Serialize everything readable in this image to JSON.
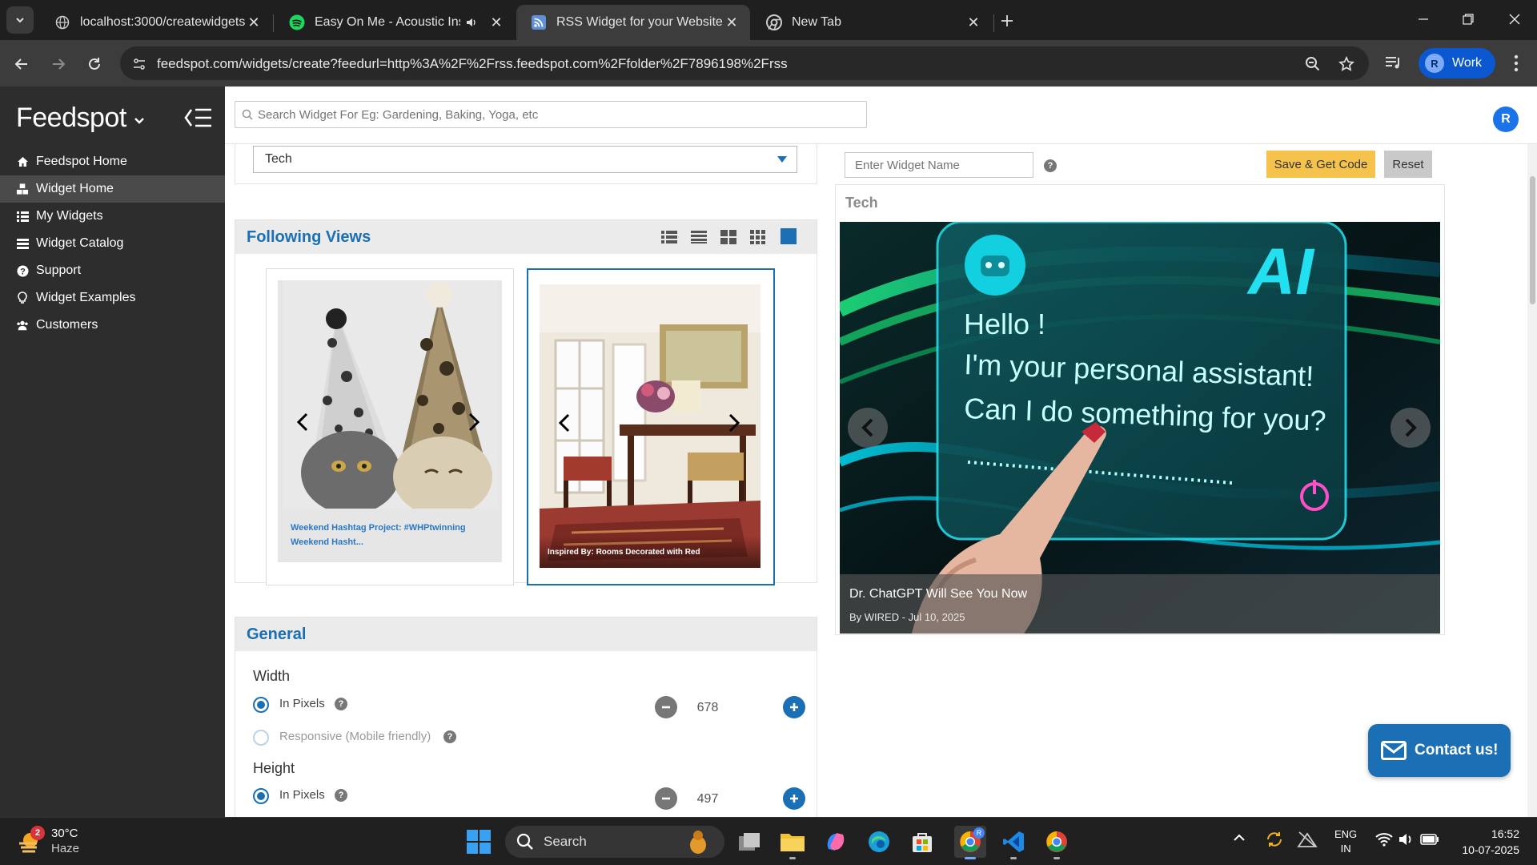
{
  "browser": {
    "tabs": [
      {
        "title": "localhost:3000/createwidgets",
        "icon": "globe-icon",
        "active": false
      },
      {
        "title": "Easy On Me - Acoustic Instr",
        "icon": "spotify-icon",
        "audio": true,
        "active": false
      },
      {
        "title": "RSS Widget for your Website | F",
        "icon": "rss-icon",
        "active": true
      },
      {
        "title": "New Tab",
        "icon": "chrome-icon",
        "active": false
      }
    ],
    "url": "feedspot.com/widgets/create?feedurl=http%3A%2F%2Frss.feedspot.com%2Ffolder%2F7896198%2Frss",
    "profile_initial": "R",
    "profile_label": "Work"
  },
  "sidebar": {
    "logo": "Feedspot",
    "items": [
      {
        "label": "Feedspot Home",
        "icon": "home-icon"
      },
      {
        "label": "Widget Home",
        "icon": "cubes-icon",
        "active": true
      },
      {
        "label": "My Widgets",
        "icon": "list-icon"
      },
      {
        "label": "Widget Catalog",
        "icon": "catalog-icon"
      },
      {
        "label": "Support",
        "icon": "question-icon"
      },
      {
        "label": "Widget Examples",
        "icon": "lightbulb-icon"
      },
      {
        "label": "Customers",
        "icon": "users-icon"
      }
    ]
  },
  "header": {
    "search_placeholder": "Search Widget For Eg: Gardening, Baking, Yoga, etc",
    "user_initial": "R"
  },
  "config": {
    "category_selected": "Tech",
    "views_title": "Following Views",
    "thumbnails": [
      {
        "caption": "Weekend Hashtag Project: #WHPtwinning Weekend Hasht...",
        "selected": false
      },
      {
        "caption": "Inspired By: Rooms Decorated with Red",
        "selected": true
      }
    ],
    "general_title": "General",
    "width": {
      "label": "Width",
      "option_pixels": "In Pixels",
      "option_responsive": "Responsive (Mobile friendly)",
      "value": "678"
    },
    "height": {
      "label": "Height",
      "option_pixels": "In Pixels",
      "value": "497"
    }
  },
  "preview": {
    "widget_name_placeholder": "Enter Widget Name",
    "save_label": "Save & Get Code",
    "reset_label": "Reset",
    "title": "Tech",
    "slide": {
      "headline": "Dr. ChatGPT Will See You Now",
      "meta": "By WIRED - Jul 10, 2025",
      "image_text": {
        "badge": "AI",
        "line1": "Hello !",
        "line2": "I'm your personal assistant!",
        "line3": "Can I do something for you?"
      }
    }
  },
  "contact_label": "Contact us!",
  "taskbar": {
    "weather_temp": "30°C",
    "weather_desc": "Haze",
    "weather_badge": "2",
    "search_label": "Search",
    "lang_top": "ENG",
    "lang_bottom": "IN",
    "time": "16:52",
    "date": "10-07-2025"
  },
  "colors": {
    "accent": "#1a6fb5",
    "save_button": "#f5c24b",
    "sidebar": "#2d2d2d"
  }
}
